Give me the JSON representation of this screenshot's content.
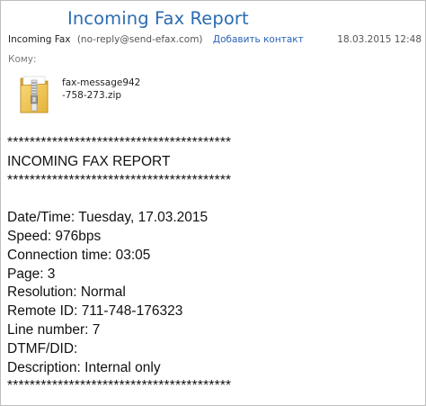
{
  "email": {
    "subject": "Incoming Fax Report",
    "sender_name": "Incoming Fax",
    "sender_email": "(no-reply@send-efax.com)",
    "add_contact_label": "Добавить контакт",
    "date": "18.03.2015 12:48",
    "to_label": "Кому:",
    "attachment": {
      "filename": "fax-message942-758-273.zip",
      "icon": "zip-folder-icon"
    },
    "body_lines": [
      "****************************************",
      "INCOMING FAX REPORT",
      "****************************************",
      "",
      "Date/Time: Tuesday, 17.03.2015",
      "Speed: 976bps",
      "Connection time: 03:05",
      "Page: 3",
      "Resolution: Normal",
      "Remote ID: 711-748-176323",
      "Line number: 7",
      "DTMF/DID:",
      "Description: Internal only",
      "****************************************"
    ]
  },
  "colors": {
    "subject": "#2b6cb0",
    "link": "#2a62b7",
    "folder": "#f2c24a"
  }
}
